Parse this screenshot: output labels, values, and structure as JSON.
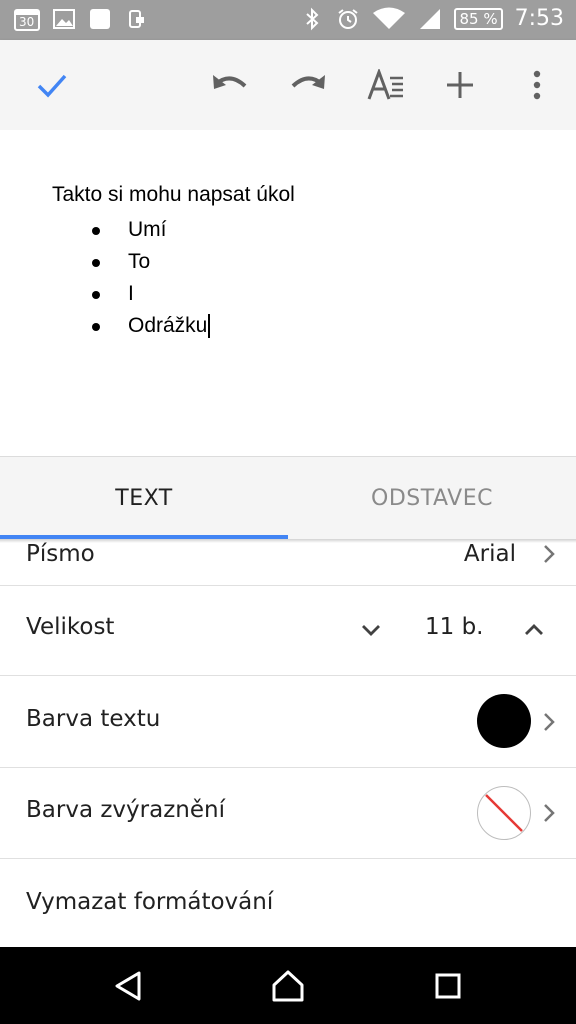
{
  "status_bar": {
    "left_icons": [
      "calendar-30-icon",
      "image-icon",
      "app-icon",
      "phone-icon"
    ],
    "calendar_day": "30",
    "right_icons": [
      "bluetooth-icon",
      "alarm-icon",
      "wifi-icon",
      "signal-icon",
      "battery-icon"
    ],
    "battery": "85 %",
    "time": "7:53"
  },
  "toolbar": {
    "buttons": [
      "check-icon",
      "undo-icon",
      "redo-icon",
      "text-format-icon",
      "insert-icon",
      "more-icon"
    ],
    "accent_color": "#4285f4"
  },
  "document": {
    "first_line": "Takto si mohu napsat úkol",
    "bullets": [
      "Umí",
      "To",
      "I",
      "Odrážku"
    ]
  },
  "format_panel": {
    "tabs": [
      {
        "label": "TEXT",
        "selected": true
      },
      {
        "label": "ODSTAVEC",
        "selected": false
      }
    ],
    "font_row": {
      "label": "Písmo",
      "value": "Arial"
    },
    "size_row": {
      "label": "Velikost",
      "value": "11 b."
    },
    "text_color_row": {
      "label": "Barva textu",
      "color": "#000000"
    },
    "highlight_row": {
      "label": "Barva zvýraznění",
      "color": "none"
    },
    "clear_row": {
      "label": "Vymazat formátování"
    }
  },
  "nav_bar": {
    "buttons": [
      "back-icon",
      "home-icon",
      "recents-icon"
    ]
  }
}
